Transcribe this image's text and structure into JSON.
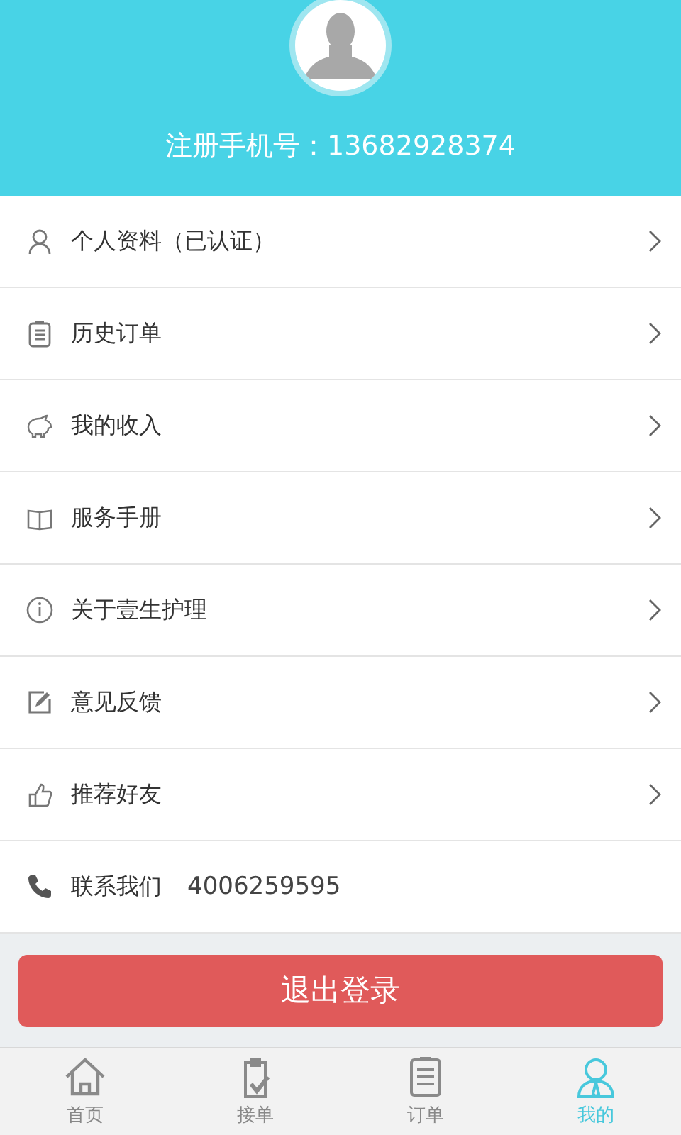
{
  "header": {
    "phone_label": "注册手机号：13682928374"
  },
  "menu": [
    {
      "kind": "link",
      "label": "个人资料（已认证）"
    },
    {
      "kind": "link",
      "label": "历史订单"
    },
    {
      "kind": "link",
      "label": "我的收入"
    },
    {
      "kind": "link",
      "label": "服务手册"
    },
    {
      "kind": "link",
      "label": "关于壹生护理"
    },
    {
      "kind": "link",
      "label": "意见反馈"
    },
    {
      "kind": "link",
      "label": "推荐好友"
    },
    {
      "kind": "contact",
      "label": "联系我们",
      "value": "4006259595"
    }
  ],
  "logout_button": "退出登录",
  "tabs": [
    {
      "label": "首页",
      "selected": false
    },
    {
      "label": "接单",
      "selected": false
    },
    {
      "label": "订单",
      "selected": false
    },
    {
      "label": "我的",
      "selected": true
    }
  ]
}
